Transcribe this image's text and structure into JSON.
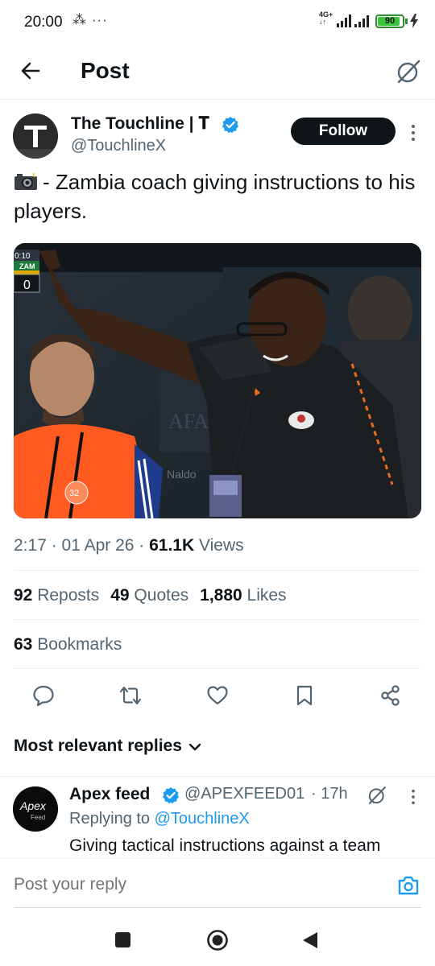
{
  "status_bar": {
    "time": "20:00",
    "misc_icons": "⁂ ···",
    "network_top": "4G+",
    "battery_level": 90,
    "battery_label": "90"
  },
  "header": {
    "title": "Post"
  },
  "post": {
    "author_name": "The Touchline | 𝐓",
    "author_handle": "@TouchlineX",
    "follow_label": "Follow",
    "text": "- Zambia coach giving instructions to his players.",
    "timestamp": "2:17 · 01 Apr 26 · ",
    "views_count": "61.1K",
    "views_label": " Views"
  },
  "media_overlay": {
    "clock": "0:10",
    "team": "ZAM",
    "score": "0",
    "bib_number": "32",
    "sponsor_text": "Naldo",
    "board_text": "AFA"
  },
  "stats": {
    "reposts_count": "92",
    "reposts_label": " Reposts",
    "quotes_count": "49",
    "quotes_label": " Quotes",
    "likes_count": "1,880",
    "likes_label": " Likes",
    "bookmarks_count": "63",
    "bookmarks_label": " Bookmarks"
  },
  "replies": {
    "heading": "Most relevant replies",
    "items": [
      {
        "avatar_text": "Apex",
        "avatar_sub": "Feed",
        "name": "Apex feed",
        "handle": "@APEXFEED01",
        "time": "· 17h",
        "replying_to_prefix": "Replying to ",
        "replying_to_handle": "@TouchlineX",
        "text": "Giving tactical instructions against a team"
      }
    ]
  },
  "compose": {
    "placeholder": "Post your reply"
  },
  "colors": {
    "accent": "#1d9bf0",
    "text_primary": "#0f1419",
    "text_secondary": "#536471",
    "follow_bg": "#0f1419"
  },
  "icons": [
    "back-arrow-icon",
    "grok-icon",
    "verified-icon",
    "more-vertical-icon",
    "camera-emoji-icon",
    "reply-icon",
    "repost-icon",
    "like-icon",
    "bookmark-icon",
    "share-icon",
    "chevron-down-icon",
    "camera-icon",
    "nav-recents-icon",
    "nav-home-icon",
    "nav-back-icon"
  ]
}
